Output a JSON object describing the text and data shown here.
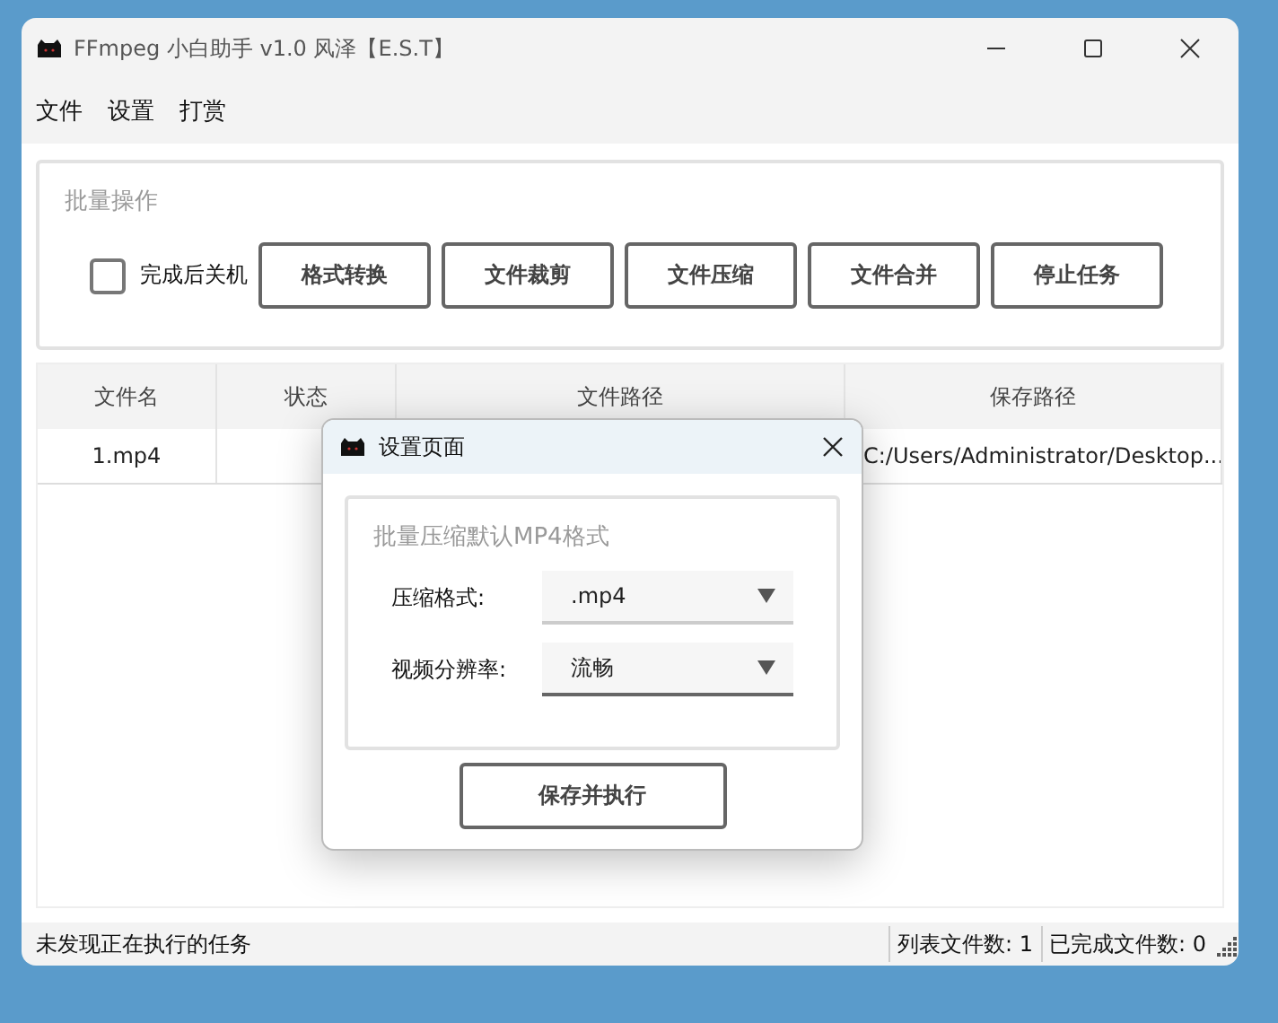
{
  "window": {
    "title": "FFmpeg 小白助手 v1.0 风泽【E.S.T】"
  },
  "menu": [
    "文件",
    "设置",
    "打赏"
  ],
  "batch": {
    "title": "批量操作",
    "shutdown": {
      "label": "完成后关机",
      "checked": false
    },
    "buttons": [
      "格式转换",
      "文件裁剪",
      "文件压缩",
      "文件合并",
      "停止任务"
    ]
  },
  "table": {
    "columns": [
      "文件名",
      "状态",
      "文件路径",
      "保存路径"
    ],
    "rows": [
      {
        "name": "1.mp4",
        "save_path": "C:/Users/Administrator/Desktop..."
      }
    ]
  },
  "status_bar": {
    "message": "未发现正在执行的任务",
    "list_count": "列表文件数: 1",
    "done_count": "已完成文件数: 0"
  },
  "dialog": {
    "title": "设置页面",
    "group_title": "批量压缩默认MP4格式",
    "fields": [
      {
        "label": "压缩格式:",
        "value": ".mp4",
        "focused": false
      },
      {
        "label": "视频分辨率:",
        "value": "流畅",
        "focused": true
      }
    ],
    "button": "保存并执行"
  }
}
